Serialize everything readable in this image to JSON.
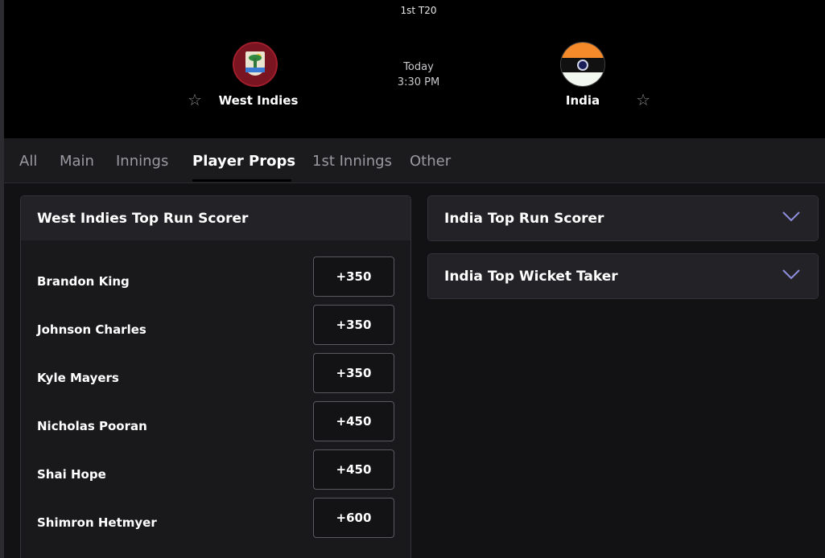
{
  "match": {
    "type": "1st T20",
    "day": "Today",
    "time": "3:30 PM",
    "home_team": {
      "name": "West Indies",
      "favorite_icon": "star-outline-icon"
    },
    "away_team": {
      "name": "India",
      "favorite_icon": "star-outline-icon"
    }
  },
  "tabs": [
    {
      "label": "All",
      "active": false
    },
    {
      "label": "Main",
      "active": false
    },
    {
      "label": "Innings",
      "active": false
    },
    {
      "label": "Player Props",
      "active": true
    },
    {
      "label": "1st Innings",
      "active": false
    },
    {
      "label": "Other",
      "active": false
    }
  ],
  "markets": {
    "wi_top_run_scorer": {
      "title": "West Indies Top Run Scorer",
      "selections": [
        {
          "player": "Brandon King",
          "odds": "+350"
        },
        {
          "player": "Johnson Charles",
          "odds": "+350"
        },
        {
          "player": "Kyle Mayers",
          "odds": "+350"
        },
        {
          "player": "Nicholas Pooran",
          "odds": "+450"
        },
        {
          "player": "Shai Hope",
          "odds": "+450"
        },
        {
          "player": "Shimron Hetmyer",
          "odds": "+600"
        }
      ]
    },
    "india_top_run_scorer": {
      "title": "India Top Run Scorer",
      "icon": "chevron-down-icon"
    },
    "india_top_wicket_taker": {
      "title": "India Top Wicket Taker",
      "icon": "chevron-down-icon"
    }
  },
  "colors": {
    "background": "#121214",
    "header": "#000000",
    "card": "#19191c",
    "card_header": "#232327",
    "chevron": "#8f8fe0"
  }
}
